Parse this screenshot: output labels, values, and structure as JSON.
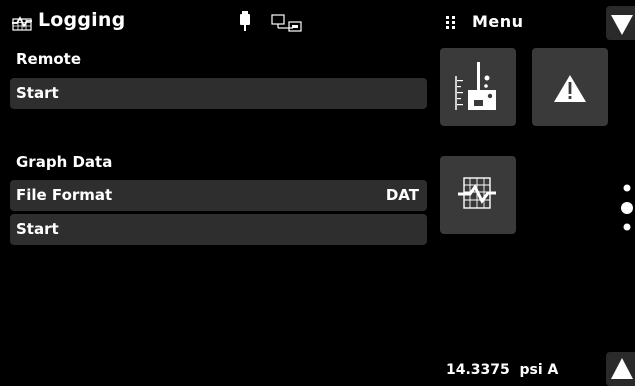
{
  "header": {
    "title": "Logging",
    "title_icon": "logging-grid-icon",
    "usb_icon": "usb-plug-icon",
    "network_icon": "network-icon",
    "menu_icon": "grid-dots-icon",
    "menu_label": "Menu",
    "scroll_down_icon": "triangle-down-icon"
  },
  "remote": {
    "section_label": "Remote",
    "start_label": "Start"
  },
  "graph_data": {
    "section_label": "Graph Data",
    "file_format_label": "File Format",
    "file_format_value": "DAT",
    "start_label": "Start"
  },
  "tiles": [
    {
      "icon": "beaker-icon"
    },
    {
      "icon": "warning-triangle-icon"
    },
    {
      "icon": "graph-data-icon"
    }
  ],
  "footer": {
    "readout": "14.3375  psi A",
    "scroll_up_icon": "triangle-up-icon"
  },
  "pager": {
    "pages": 3,
    "current": 2
  },
  "colors": {
    "background": "#000000",
    "row_bg": "#2e2e2e",
    "tile_bg": "#3a3a3a",
    "text": "#ffffff"
  }
}
